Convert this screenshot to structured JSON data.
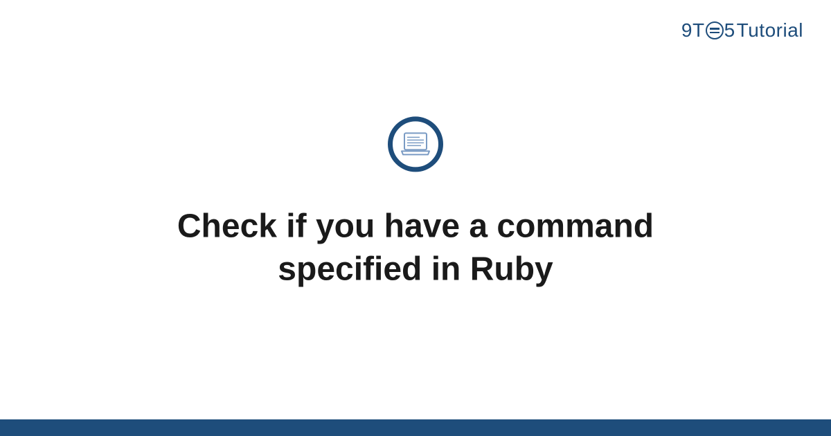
{
  "logo": {
    "part1": "9T",
    "part2": "5",
    "part3": "Tutorial"
  },
  "title": "Check if you have a command specified in Ruby",
  "colors": {
    "brand": "#1e4d7b",
    "icon_stroke": "#7a9bc4"
  }
}
